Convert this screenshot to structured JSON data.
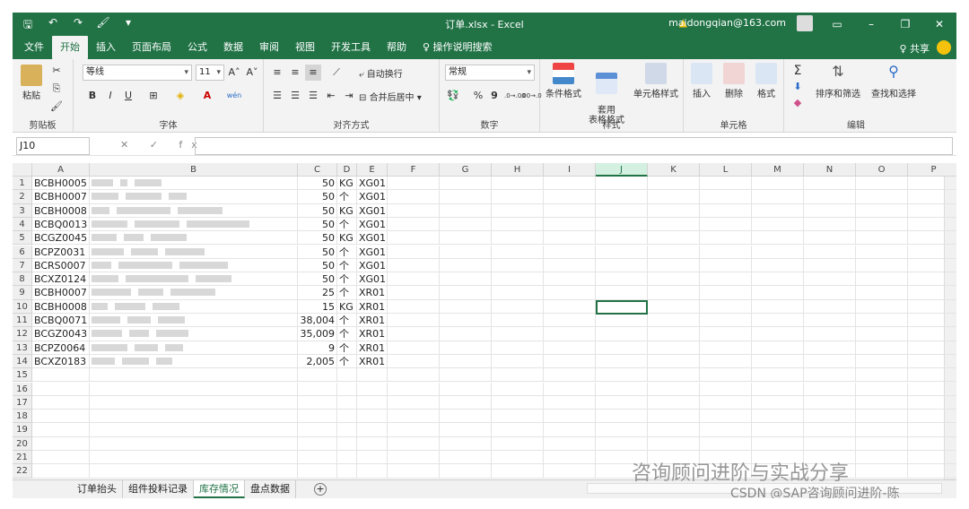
{
  "window": {
    "title": "订单.xlsx - Excel",
    "account": "maidongqian@163.com",
    "controls": [
      "▭",
      "–",
      "❐",
      "✕"
    ]
  },
  "qat": {
    "save": "🖫",
    "undo": "↶",
    "redo": "↷",
    "paint": "🖌",
    "more": "▾"
  },
  "menu": {
    "items": [
      "文件",
      "开始",
      "插入",
      "页面布局",
      "公式",
      "数据",
      "审阅",
      "视图",
      "开发工具",
      "帮助",
      "♀ 操作说明搜索"
    ],
    "active_index": 1,
    "share": "♀ 共享"
  },
  "ribbon": {
    "clipboard": {
      "label": "剪贴板",
      "paste": "粘贴"
    },
    "font": {
      "label": "字体",
      "font_name": "等线",
      "font_size": "11",
      "bold": "B",
      "italic": "I",
      "underline": "U",
      "grow": "A˄",
      "shrink": "A˅",
      "wen": "wén"
    },
    "alignment": {
      "label": "对齐方式",
      "wrap": "自动换行",
      "merge": "合并后居中"
    },
    "number": {
      "label": "数字",
      "format": "常规",
      "percent": "%",
      "comma": "9",
      "inc": ".0→.00",
      "dec": ".00→.0"
    },
    "styles": {
      "label": "样式",
      "cond": "条件格式",
      "table": "套用\n表格格式",
      "cell": "单元格样式"
    },
    "cells": {
      "label": "单元格",
      "insert": "插入",
      "delete": "删除",
      "format": "格式"
    },
    "editing": {
      "label": "编辑",
      "sigma": "Σ",
      "sort": "排序和筛选",
      "find": "查找和选择"
    }
  },
  "formula_bar": {
    "name_box": "J10",
    "fx": "✕ ✓ fx",
    "value": ""
  },
  "columns": [
    "A",
    "B",
    "C",
    "D",
    "E",
    "F",
    "G",
    "H",
    "I",
    "J",
    "K",
    "L",
    "M",
    "N",
    "O",
    "P"
  ],
  "selected_column": "J",
  "rows": [
    {
      "n": "1",
      "a": "BCBH0005",
      "c": "50",
      "d": "KG",
      "e": "XG01"
    },
    {
      "n": "2",
      "a": "BCBH0007",
      "c": "50",
      "d": "个",
      "e": "XG01"
    },
    {
      "n": "3",
      "a": "BCBH0008",
      "c": "50",
      "d": "KG",
      "e": "XG01"
    },
    {
      "n": "4",
      "a": "BCBQ0013",
      "c": "50",
      "d": "个",
      "e": "XG01"
    },
    {
      "n": "5",
      "a": "BCGZ0045",
      "c": "50",
      "d": "KG",
      "e": "XG01"
    },
    {
      "n": "6",
      "a": "BCPZ0031",
      "c": "50",
      "d": "个",
      "e": "XG01"
    },
    {
      "n": "7",
      "a": "BCRS0007",
      "c": "50",
      "d": "个",
      "e": "XG01"
    },
    {
      "n": "8",
      "a": "BCXZ0124",
      "c": "50",
      "d": "个",
      "e": "XG01"
    },
    {
      "n": "9",
      "a": "BCBH0007",
      "c": "25",
      "d": "个",
      "e": "XR01"
    },
    {
      "n": "10",
      "a": "BCBH0008",
      "c": "15",
      "d": "KG",
      "e": "XR01"
    },
    {
      "n": "11",
      "a": "BCBQ0071",
      "c": "38,004",
      "d": "个",
      "e": "XR01"
    },
    {
      "n": "12",
      "a": "BCGZ0043",
      "c": "35,009",
      "d": "个",
      "e": "XR01"
    },
    {
      "n": "13",
      "a": "BCPZ0064",
      "c": "9",
      "d": "个",
      "e": "XR01"
    },
    {
      "n": "14",
      "a": "BCXZ0183",
      "c": "2,005",
      "d": "个",
      "e": "XR01"
    },
    {
      "n": "15"
    },
    {
      "n": "16"
    },
    {
      "n": "17"
    },
    {
      "n": "18"
    },
    {
      "n": "19"
    },
    {
      "n": "20"
    },
    {
      "n": "21"
    },
    {
      "n": "22"
    }
  ],
  "sheet_tabs": [
    "订单抬头",
    "组件投料记录",
    "库存情况",
    "盘点数据"
  ],
  "active_tab_index": 2,
  "add_tab": "+",
  "watermark": "咨询顾问进阶与实战分享",
  "watermark2": "CSDN @SAP咨询顾问进阶-陈",
  "colors": {
    "accent": "#217346"
  }
}
